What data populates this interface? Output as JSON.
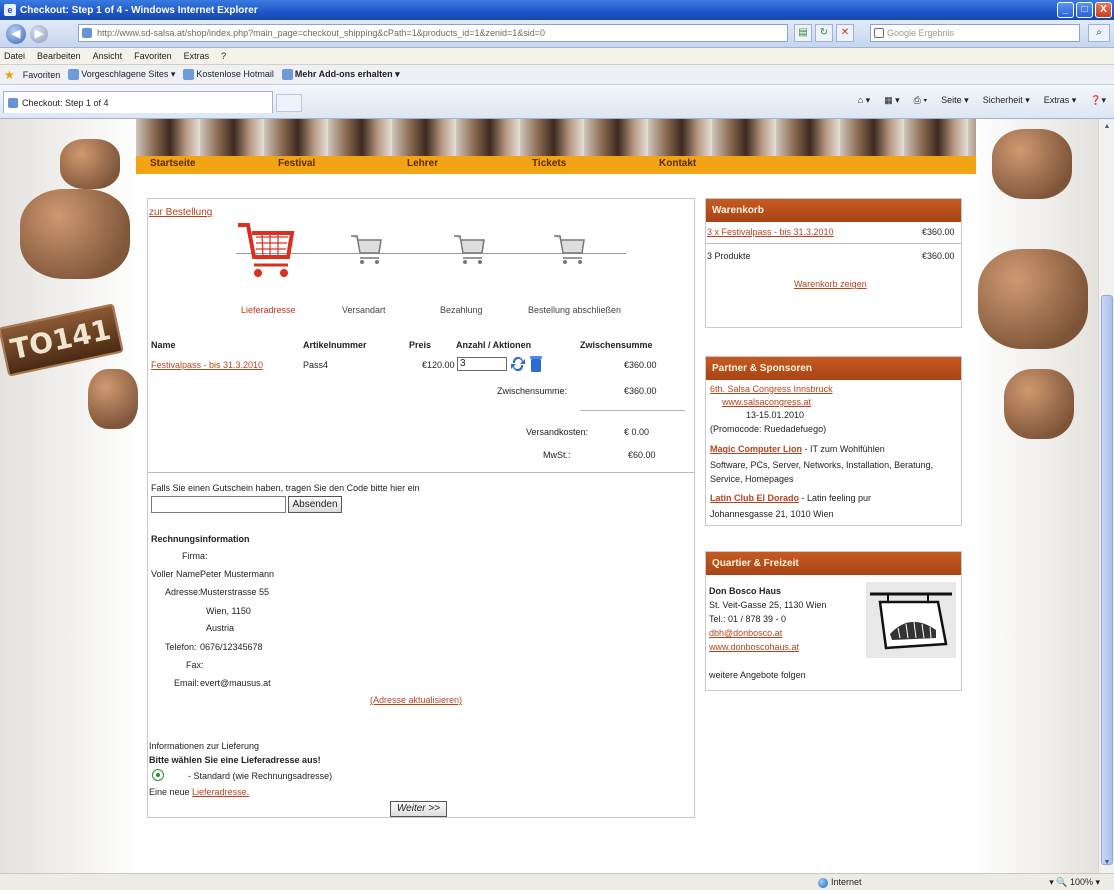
{
  "window": {
    "title": "Checkout: Step 1 of 4 - Windows Internet Explorer",
    "minimize": "_",
    "maximize": "□",
    "close": "X"
  },
  "addressbar": {
    "url": "http://www.sd-salsa.at/shop/index.php?main_page=checkout_shipping&cPath=1&products_id=1&zenid=1&sid=0",
    "search_placeholder": "Google Ergebnis"
  },
  "menu": [
    "Datei",
    "Bearbeiten",
    "Ansicht",
    "Favoriten",
    "Extras",
    "?"
  ],
  "favorites": {
    "label": "Favoriten",
    "items": [
      "Vorgeschlagene Sites ▾",
      "Kostenlose Hotmail",
      "Mehr Add-ons erhalten ▾"
    ]
  },
  "tab": {
    "label": "Checkout: Step 1 of 4"
  },
  "commandbar": [
    "Seite ▾",
    "Sicherheit ▾",
    "Extras ▾"
  ],
  "site": {
    "nav": [
      "Startseite",
      "Festival",
      "Lehrer",
      "Tickets",
      "Kontakt"
    ],
    "plate": "TO141"
  },
  "checkout": {
    "back_link": "zur Bestellung",
    "steps": [
      "Lieferadresse",
      "Versandart",
      "Bezahlung",
      "Bestellung abschließen"
    ],
    "columns": [
      "Name",
      "Artikelnummer",
      "Preis",
      "Anzahl / Aktionen",
      "Zwischensumme"
    ],
    "item": {
      "name": "Festivalpass - bis 31.3.2010",
      "sku": "Pass4",
      "price": "€120.00",
      "qty": "3",
      "subtotal": "€360.00"
    },
    "zwischensumme_label": "Zwischensumme:",
    "zwischensumme_value": "€360.00",
    "versand_label": "Versandkosten:",
    "versand_value": "€ 0.00",
    "mwst_label": "MwSt.:",
    "mwst_value": "€60.00",
    "coupon_text": "Falls Sie einen Gutschein haben, tragen Sie den Code bitte hier ein",
    "submit_label": "Absenden",
    "billing_title": "Rechnungsinformation",
    "billing": [
      {
        "label": "Firma:",
        "value": ""
      },
      {
        "label": "Voller Name:",
        "value": "Peter Mustermann"
      },
      {
        "label": "Adresse:",
        "value": "Musterstrasse 55"
      },
      {
        "label": "",
        "value": "Wien, 1150"
      },
      {
        "label": "",
        "value": "Austria"
      },
      {
        "label": "Telefon:",
        "value": "0676/12345678"
      },
      {
        "label": "Fax:",
        "value": ""
      },
      {
        "label": "Email:",
        "value": "evert@mausus.at"
      }
    ],
    "edit_address_link": "(Adresse aktualisieren)",
    "delivery_info": "Informationen zur Lieferung",
    "delivery_choose": "Bitte wählen Sie eine Lieferadresse aus!",
    "delivery_default": "- Standard (wie Rechnungsadresse)",
    "new_address_prefix": "Eine neue ",
    "new_address_link": "Lieferadresse.",
    "next_label": "Weiter >>"
  },
  "cart": {
    "title": "Warenkorb",
    "item": "3 x Festivalpass - bis 31.3.2010",
    "item_price": "€360.00",
    "count": "3 Produkte",
    "total": "€360.00",
    "show_link": "Warenkorb zeigen"
  },
  "partners": {
    "title": "Partner & Sponsoren",
    "p1_name": "6th. Salsa Congress Innsbruck",
    "p1_link": "www.salsacongress.at",
    "p1_date": "13-15.01.2010",
    "p1_code": "(Promocode: Ruedadefuego)",
    "p2_name": "Magic Computer Lion",
    "p2_tag": " - IT zum Wohlfühlen",
    "p2_desc": "Software, PCs, Server, Networks, Installation, Beratung, Service, Homepages",
    "p3_name": "Latin Club El Dorado",
    "p3_tag": " - Latin feeling pur",
    "p3_addr": "Johannesgasse 21, 1010 Wien"
  },
  "quarters": {
    "title": "Quartier & Freizeit",
    "name": "Don Bosco Haus",
    "addr": "St. Veit-Gasse 25, 1130 Wien",
    "tel": "Tel.: 01 / 878 39 - 0",
    "email": "dbh@donbosco.at",
    "web": "www.donboscohaus.at",
    "more": "weitere Angebote folgen"
  },
  "status": {
    "zone": "Internet",
    "zoom": "100%"
  }
}
